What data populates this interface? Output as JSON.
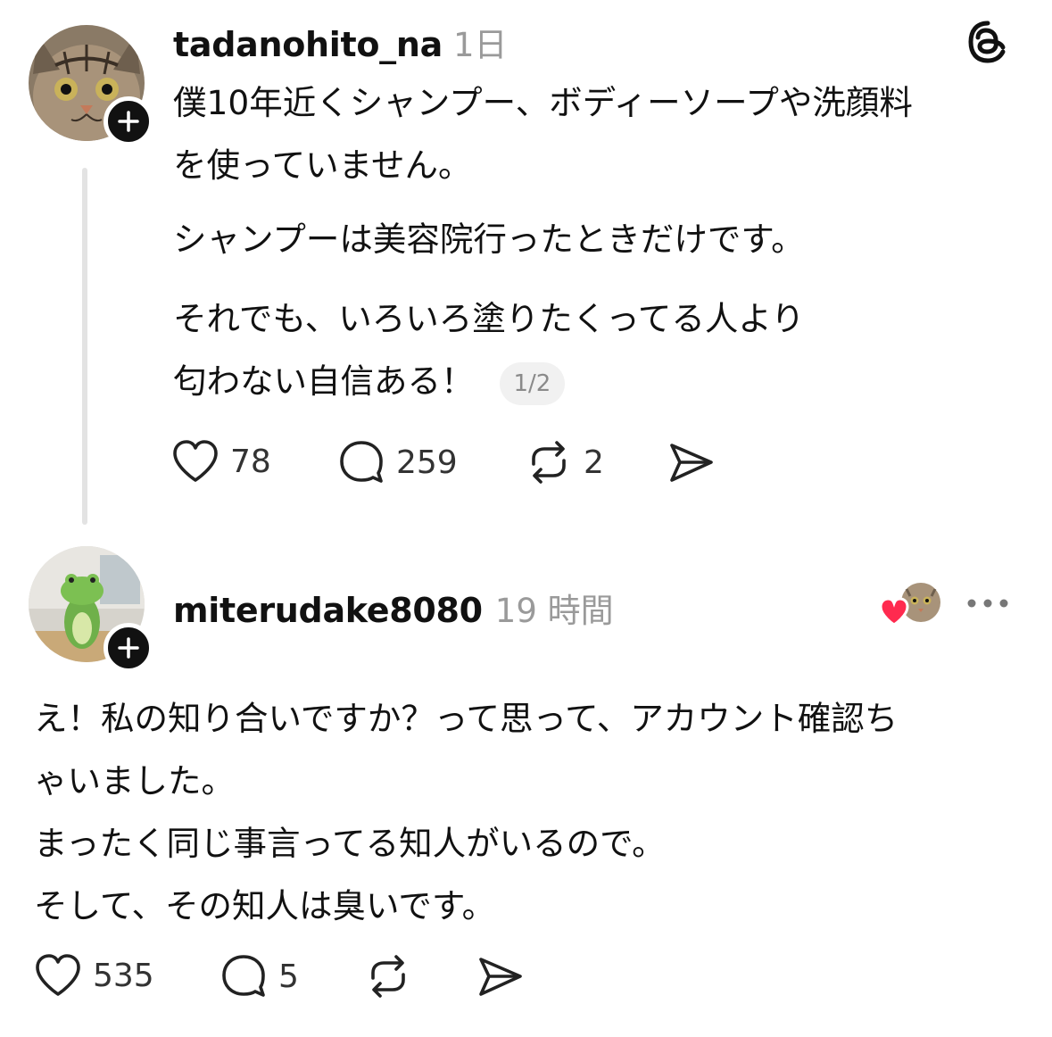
{
  "posts": [
    {
      "username": "tadanohito_na",
      "timestamp": "1日",
      "avatar_icon": "tabby-cat-avatar",
      "lines": [
        "僕10年近くシャンプー、ボディーソープや洗顔料",
        "を使っていません。",
        "シャンプーは美容院行ったときだけです。",
        "それでも、いろいろ塗りたくってる人より",
        "匂わない自信ある！"
      ],
      "page_indicator": "1/2",
      "actions": {
        "likes": "78",
        "replies": "259",
        "reposts": "2"
      }
    },
    {
      "username": "miterudake8080",
      "timestamp": "19 時間",
      "avatar_icon": "frog-figure-avatar",
      "lines": [
        "え！私の知り合いですか？って思って、アカウント確認ち",
        "ゃいました。",
        "まったく同じ事言ってる知人がいるので。",
        "そして、その知人は臭いです。"
      ],
      "actions": {
        "likes": "535",
        "replies": "5"
      }
    }
  ],
  "colors": {
    "text": "#111111",
    "muted": "#9a9a9a",
    "heart": "#ff2a4f",
    "thread_line": "#e3e3e3"
  }
}
